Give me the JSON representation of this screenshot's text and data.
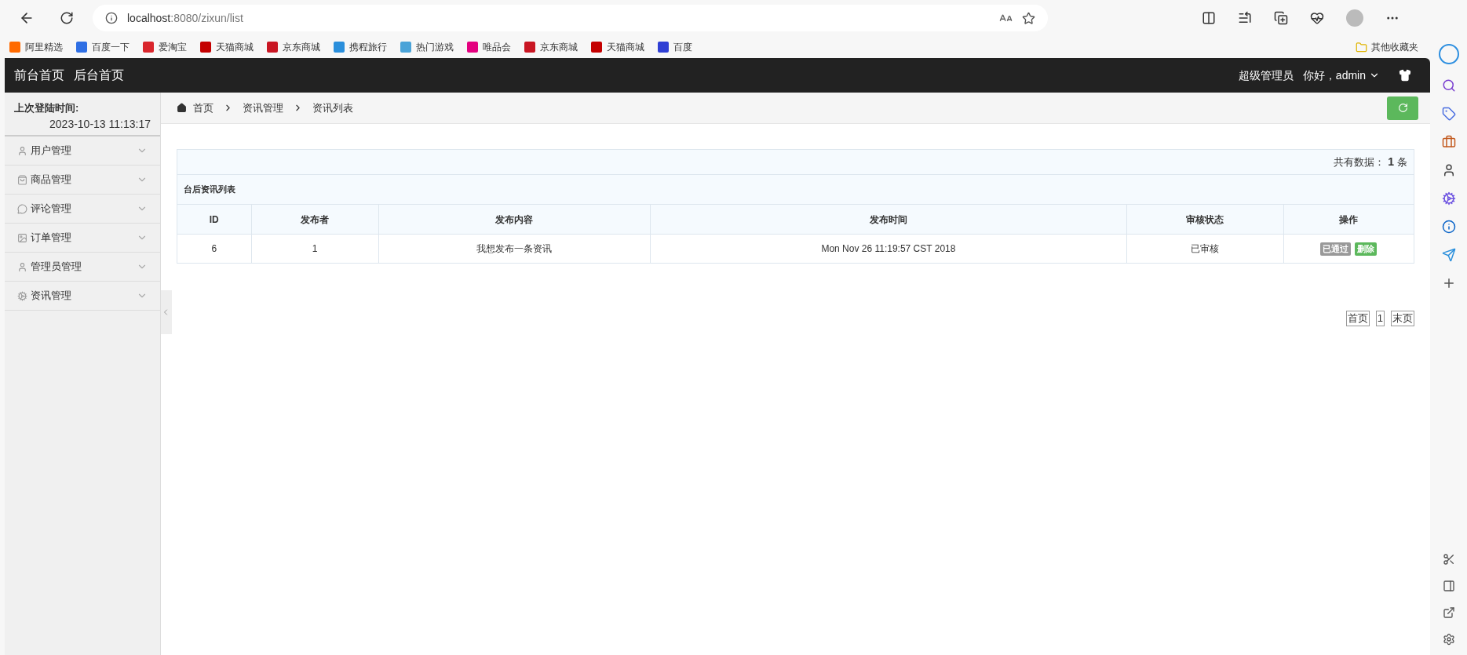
{
  "browser": {
    "url_host": "localhost",
    "url_path": ":8080/zixun/list",
    "bookmarks": [
      {
        "label": "阿里精选",
        "color": "#ff6a00"
      },
      {
        "label": "百度一下",
        "color": "#2f6fe4"
      },
      {
        "label": "爱淘宝",
        "color": "#d9262c"
      },
      {
        "label": "天猫商城",
        "color": "#c40000"
      },
      {
        "label": "京东商城",
        "color": "#c91623"
      },
      {
        "label": "携程旅行",
        "color": "#2a8fdc"
      },
      {
        "label": "热门游戏",
        "color": "#4aa3d8"
      },
      {
        "label": "唯品会",
        "color": "#e4007f"
      },
      {
        "label": "京东商城",
        "color": "#c91623"
      },
      {
        "label": "天猫商城",
        "color": "#c40000"
      },
      {
        "label": "百度",
        "color": "#2f3fd4"
      }
    ],
    "other_bookmarks": "其他收藏夹"
  },
  "header": {
    "links": [
      "前台首页",
      "后台首页"
    ],
    "role": "超级管理员",
    "greeting": "你好，admin"
  },
  "sidebar": {
    "login_label": "上次登陆时间:",
    "login_time": "2023-10-13 11:13:17",
    "items": [
      {
        "label": "用户管理",
        "kind": "user",
        "expanded": false
      },
      {
        "label": "商品管理",
        "kind": "bag",
        "expanded": false
      },
      {
        "label": "评论管理",
        "kind": "comment",
        "expanded": false
      },
      {
        "label": "订单管理",
        "kind": "image",
        "expanded": false
      },
      {
        "label": "管理员管理",
        "kind": "admin",
        "expanded": false
      },
      {
        "label": "资讯管理",
        "kind": "gear",
        "expanded": false
      }
    ]
  },
  "breadcrumb": [
    "首页",
    "资讯管理",
    "资讯列表"
  ],
  "summary": {
    "label": "共有数据：",
    "count": "1",
    "unit": "条"
  },
  "table": {
    "title": "台后资讯列表",
    "columns": [
      "ID",
      "发布者",
      "发布内容",
      "发布时间",
      "审核状态",
      "操作"
    ],
    "rows": [
      {
        "cells": [
          "6",
          "1",
          "我想发布一条资讯",
          "Mon Nov 26 11:19:57 CST 2018",
          "已审核"
        ],
        "actions": [
          {
            "label": "已通过",
            "kind": "passed"
          },
          {
            "label": "删除",
            "kind": "delete"
          }
        ]
      }
    ]
  },
  "pagination": [
    {
      "label": "首页"
    },
    {
      "label": "1"
    },
    {
      "label": "末页"
    }
  ]
}
